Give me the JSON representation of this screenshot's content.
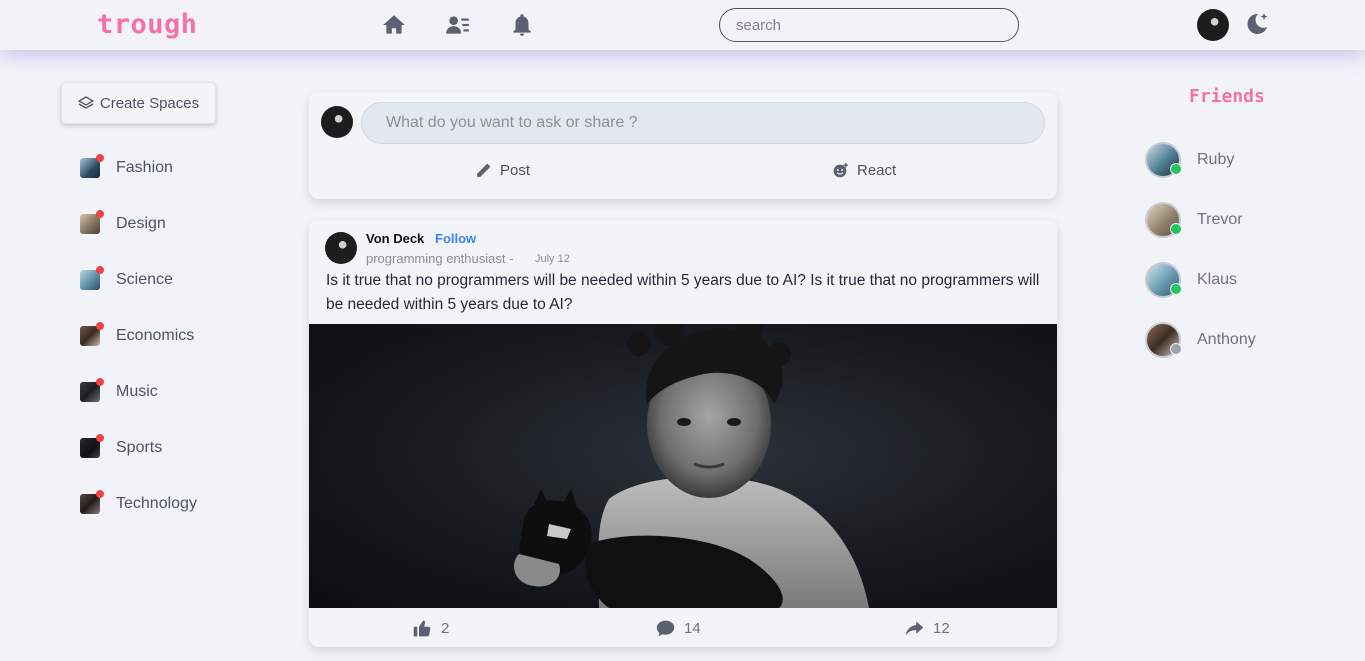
{
  "app": {
    "logo": "trough"
  },
  "colors": {
    "brand": "#f472a8",
    "accent": "#3b82f6",
    "online": "#22c55e",
    "offline": "#9ca3af",
    "notify": "#ef4444"
  },
  "header": {
    "icons": [
      "home-icon",
      "user-list-icon",
      "bell-icon"
    ],
    "search_placeholder": "search",
    "theme_icon": "moon-sparkle-icon"
  },
  "sidebar": {
    "create_label": "Create Spaces",
    "spaces": [
      {
        "label": "Fashion"
      },
      {
        "label": "Design"
      },
      {
        "label": "Science"
      },
      {
        "label": "Economics"
      },
      {
        "label": "Music"
      },
      {
        "label": "Sports"
      },
      {
        "label": "Technology"
      }
    ]
  },
  "composer": {
    "placeholder": "What do you want to ask or share ?",
    "post_label": "Post",
    "react_label": "React"
  },
  "post": {
    "author": "Von Deck",
    "follow_label": "Follow",
    "role": "programming enthusiast -",
    "date": "July 12",
    "text": "Is it true that no programmers will be needed within 5 years due to AI? Is it true that no programmers will be needed within 5 years due to AI?",
    "likes": "2",
    "comments": "14",
    "shares": "12"
  },
  "friends": {
    "title": "Friends",
    "list": [
      {
        "name": "Ruby",
        "status": "online"
      },
      {
        "name": "Trevor",
        "status": "online"
      },
      {
        "name": "Klaus",
        "status": "online"
      },
      {
        "name": "Anthony",
        "status": "offline"
      }
    ]
  }
}
